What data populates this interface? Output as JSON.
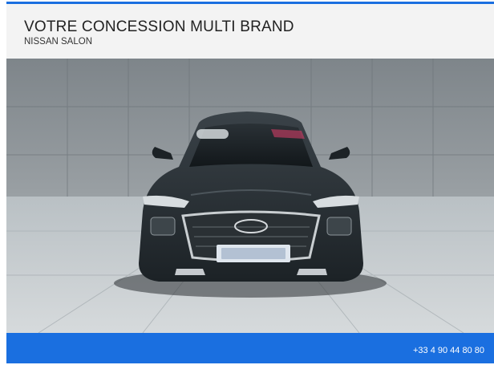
{
  "header": {
    "title": "VOTRE CONCESSION MULTI BRAND",
    "subtitle": "NISSAN SALON"
  },
  "photo": {
    "subject": "car-photo"
  },
  "footer": {
    "phone": "+33 4 90 44 80 80"
  },
  "colors": {
    "accent": "#1a6fe0",
    "header_bg": "#f3f3f3",
    "footer_text": "#ffffff"
  }
}
